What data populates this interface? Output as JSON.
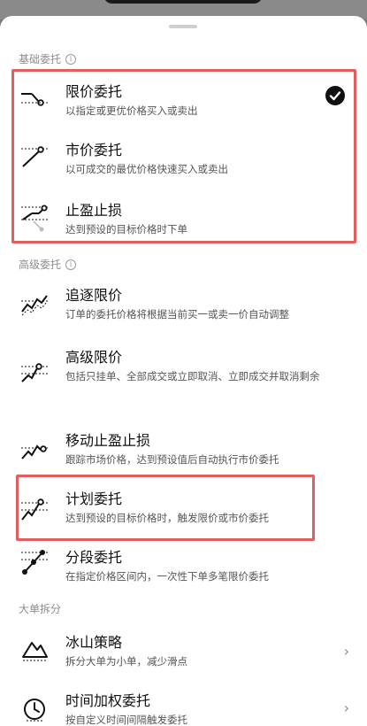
{
  "sections": {
    "basic": "基础委托",
    "advanced": "高级委托",
    "large": "大单拆分"
  },
  "basic_items": [
    {
      "title": "限价委托",
      "desc": "以指定或更优价格买入或卖出",
      "icon": "limit-order-icon"
    },
    {
      "title": "市价委托",
      "desc": "以可成交的最优价格快速买入或卖出",
      "icon": "market-order-icon"
    },
    {
      "title": "止盈止损",
      "desc": "达到预设的目标价格时下单",
      "icon": "stop-loss-icon"
    }
  ],
  "advanced_items": [
    {
      "title": "追逐限价",
      "desc": "订单的委托价格将根据当前买一或卖一价自动调整",
      "icon": "chase-limit-icon"
    },
    {
      "title": "高级限价",
      "desc": "包括只挂单、全部成交或立即取消、立即成交并取消剩余",
      "icon": "advanced-limit-icon"
    },
    {
      "title": "移动止盈止损",
      "desc": "跟踪市场价格，达到预设值后自动执行市价委托",
      "icon": "trailing-stop-icon"
    },
    {
      "title": "计划委托",
      "desc": "达到预设的目标价格时，触发限价或市价委托",
      "icon": "plan-order-icon"
    },
    {
      "title": "分段委托",
      "desc": "在指定价格区间内，一次性下单多笔限价委托",
      "icon": "segment-order-icon"
    }
  ],
  "large_items": [
    {
      "title": "冰山策略",
      "desc": "拆分大单为小单，减少滑点",
      "icon": "iceberg-icon"
    },
    {
      "title": "时间加权委托",
      "desc": "按自定义时间间隔触发委托",
      "icon": "twap-clock-icon"
    }
  ],
  "selected": "限价委托"
}
